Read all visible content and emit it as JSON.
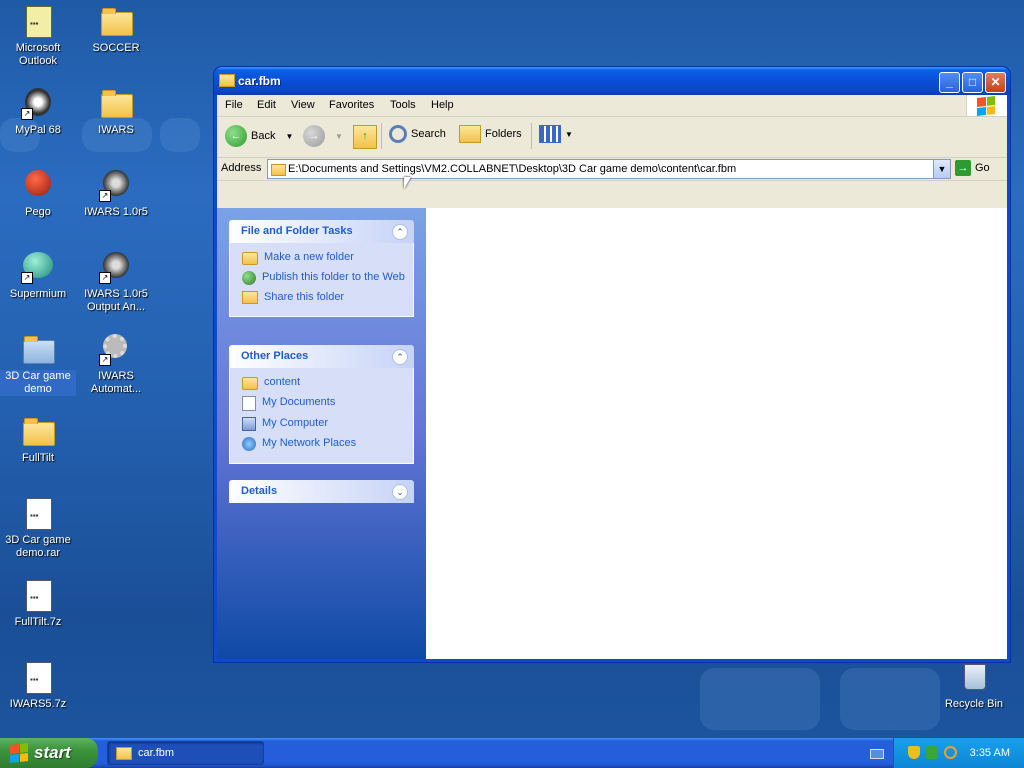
{
  "desktop": {
    "icons": [
      {
        "label": "Microsoft Outlook",
        "icon": "outlook-icon"
      },
      {
        "label": "SOCCER",
        "icon": "zip-folder-icon"
      },
      {
        "label": "MyPal 68",
        "icon": "mypal-icon"
      },
      {
        "label": "IWARS",
        "icon": "folder-icon"
      },
      {
        "label": "Pego",
        "icon": "pego-icon"
      },
      {
        "label": "IWARS 1.0r5",
        "icon": "iwars-icon"
      },
      {
        "label": "Supermium",
        "icon": "supermium-icon"
      },
      {
        "label": "IWARS 1.0r5 Output An...",
        "icon": "iwars-icon"
      },
      {
        "label": "3D Car game demo",
        "icon": "folder-icon",
        "selected": true
      },
      {
        "label": "IWARS Automat...",
        "icon": "gear-icon"
      },
      {
        "label": "FullTilt",
        "icon": "folder-icon"
      },
      {
        "label": "3D Car game demo.rar",
        "icon": "archive-icon"
      },
      {
        "label": "FullTilt.7z",
        "icon": "archive-icon"
      },
      {
        "label": "IWARS5.7z",
        "icon": "archive-icon"
      },
      {
        "label": "Recycle Bin",
        "icon": "recycle-bin-icon"
      }
    ]
  },
  "window": {
    "title": "car.fbm",
    "menu": [
      "File",
      "Edit",
      "View",
      "Favorites",
      "Tools",
      "Help"
    ],
    "toolbar": {
      "back": "Back",
      "search": "Search",
      "folders": "Folders"
    },
    "address": {
      "label": "Address",
      "value": "E:\\Documents and Settings\\VM2.COLLABNET\\Desktop\\3D Car game demo\\content\\car.fbm",
      "go": "Go"
    },
    "tasks": {
      "file_folder": {
        "title": "File and Folder Tasks",
        "items": [
          "Make a new folder",
          "Publish this folder to the Web",
          "Share this folder"
        ]
      },
      "other_places": {
        "title": "Other Places",
        "items": [
          "content",
          "My Documents",
          "My Computer",
          "My Network Places"
        ]
      },
      "details": {
        "title": "Details"
      }
    }
  },
  "taskbar": {
    "start": "start",
    "task": "car.fbm",
    "clock": "3:35 AM"
  },
  "colors": {
    "accent": "#0a4ed6",
    "taskpane_link": "#215dc6",
    "start_green": "#3c943c"
  }
}
